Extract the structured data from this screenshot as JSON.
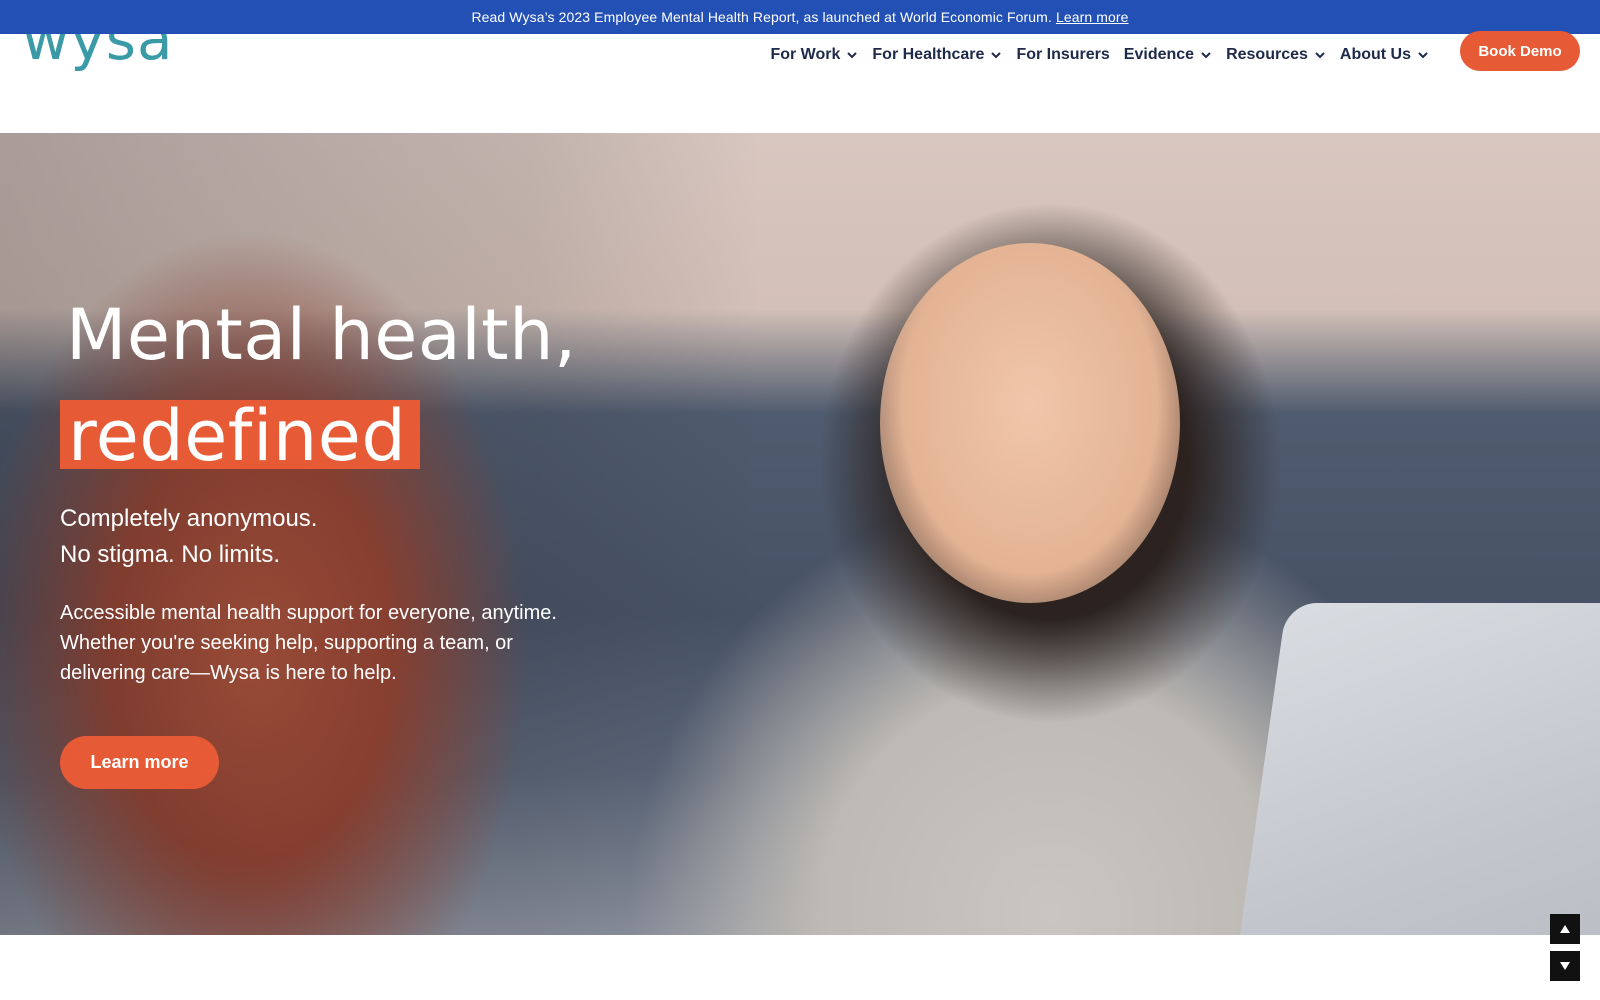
{
  "announcement": {
    "text": "Read Wysa’s 2023 Employee Mental Health Report, as launched at World Economic Forum.",
    "link": "Learn more"
  },
  "brand": {
    "logo_text": "wysa",
    "logo_color": "#3a9aa6",
    "accent_color": "#e65a35",
    "announce_color": "#2350b4"
  },
  "nav": {
    "items": [
      {
        "label": "For Work",
        "dropdown": true
      },
      {
        "label": "For Healthcare",
        "dropdown": true
      },
      {
        "label": "For Insurers",
        "dropdown": false
      },
      {
        "label": "Evidence",
        "dropdown": true
      },
      {
        "label": "Resources",
        "dropdown": true
      },
      {
        "label": "About Us",
        "dropdown": true
      }
    ],
    "cta": "Book Demo"
  },
  "hero": {
    "title_line1": "Mental health,",
    "title_line2": "redefined",
    "subtitle_line1": "Completely anonymous.",
    "subtitle_line2": "No stigma. No limits.",
    "desc_line1": "Accessible mental health support for everyone, anytime.",
    "desc_line2": "Whether you're seeking help, supporting a team, or",
    "desc_line3": "delivering care—Wysa is here to help.",
    "cta": "Learn more"
  },
  "scroll": {
    "up_icon": "triangle-up-icon",
    "down_icon": "triangle-down-icon"
  }
}
